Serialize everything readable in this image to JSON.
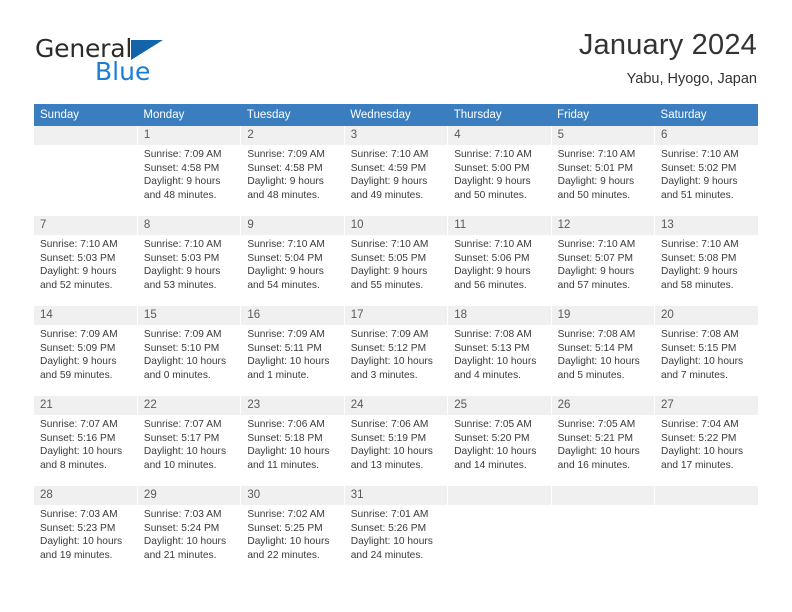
{
  "brand": {
    "name_part1": "General",
    "name_part2": "Blue",
    "triangle_color": "#1464aa",
    "blue_text_color": "#1a7fd4"
  },
  "header": {
    "title": "January 2024",
    "subtitle": "Yabu, Hyogo, Japan"
  },
  "theme": {
    "header_row_bg": "#3a7ebf",
    "daynum_bg": "#f0f0f0",
    "text_color": "#3b3b3b"
  },
  "weekday_headers": [
    "Sunday",
    "Monday",
    "Tuesday",
    "Wednesday",
    "Thursday",
    "Friday",
    "Saturday"
  ],
  "weeks": [
    [
      {
        "day": "",
        "sunrise": "",
        "sunset": "",
        "daylight": "",
        "daylight2": "",
        "empty": true
      },
      {
        "day": "1",
        "sunrise": "Sunrise: 7:09 AM",
        "sunset": "Sunset: 4:58 PM",
        "daylight": "Daylight: 9 hours",
        "daylight2": "and 48 minutes."
      },
      {
        "day": "2",
        "sunrise": "Sunrise: 7:09 AM",
        "sunset": "Sunset: 4:58 PM",
        "daylight": "Daylight: 9 hours",
        "daylight2": "and 48 minutes."
      },
      {
        "day": "3",
        "sunrise": "Sunrise: 7:10 AM",
        "sunset": "Sunset: 4:59 PM",
        "daylight": "Daylight: 9 hours",
        "daylight2": "and 49 minutes."
      },
      {
        "day": "4",
        "sunrise": "Sunrise: 7:10 AM",
        "sunset": "Sunset: 5:00 PM",
        "daylight": "Daylight: 9 hours",
        "daylight2": "and 50 minutes."
      },
      {
        "day": "5",
        "sunrise": "Sunrise: 7:10 AM",
        "sunset": "Sunset: 5:01 PM",
        "daylight": "Daylight: 9 hours",
        "daylight2": "and 50 minutes."
      },
      {
        "day": "6",
        "sunrise": "Sunrise: 7:10 AM",
        "sunset": "Sunset: 5:02 PM",
        "daylight": "Daylight: 9 hours",
        "daylight2": "and 51 minutes."
      }
    ],
    [
      {
        "day": "7",
        "sunrise": "Sunrise: 7:10 AM",
        "sunset": "Sunset: 5:03 PM",
        "daylight": "Daylight: 9 hours",
        "daylight2": "and 52 minutes."
      },
      {
        "day": "8",
        "sunrise": "Sunrise: 7:10 AM",
        "sunset": "Sunset: 5:03 PM",
        "daylight": "Daylight: 9 hours",
        "daylight2": "and 53 minutes."
      },
      {
        "day": "9",
        "sunrise": "Sunrise: 7:10 AM",
        "sunset": "Sunset: 5:04 PM",
        "daylight": "Daylight: 9 hours",
        "daylight2": "and 54 minutes."
      },
      {
        "day": "10",
        "sunrise": "Sunrise: 7:10 AM",
        "sunset": "Sunset: 5:05 PM",
        "daylight": "Daylight: 9 hours",
        "daylight2": "and 55 minutes."
      },
      {
        "day": "11",
        "sunrise": "Sunrise: 7:10 AM",
        "sunset": "Sunset: 5:06 PM",
        "daylight": "Daylight: 9 hours",
        "daylight2": "and 56 minutes."
      },
      {
        "day": "12",
        "sunrise": "Sunrise: 7:10 AM",
        "sunset": "Sunset: 5:07 PM",
        "daylight": "Daylight: 9 hours",
        "daylight2": "and 57 minutes."
      },
      {
        "day": "13",
        "sunrise": "Sunrise: 7:10 AM",
        "sunset": "Sunset: 5:08 PM",
        "daylight": "Daylight: 9 hours",
        "daylight2": "and 58 minutes."
      }
    ],
    [
      {
        "day": "14",
        "sunrise": "Sunrise: 7:09 AM",
        "sunset": "Sunset: 5:09 PM",
        "daylight": "Daylight: 9 hours",
        "daylight2": "and 59 minutes."
      },
      {
        "day": "15",
        "sunrise": "Sunrise: 7:09 AM",
        "sunset": "Sunset: 5:10 PM",
        "daylight": "Daylight: 10 hours",
        "daylight2": "and 0 minutes."
      },
      {
        "day": "16",
        "sunrise": "Sunrise: 7:09 AM",
        "sunset": "Sunset: 5:11 PM",
        "daylight": "Daylight: 10 hours",
        "daylight2": "and 1 minute."
      },
      {
        "day": "17",
        "sunrise": "Sunrise: 7:09 AM",
        "sunset": "Sunset: 5:12 PM",
        "daylight": "Daylight: 10 hours",
        "daylight2": "and 3 minutes."
      },
      {
        "day": "18",
        "sunrise": "Sunrise: 7:08 AM",
        "sunset": "Sunset: 5:13 PM",
        "daylight": "Daylight: 10 hours",
        "daylight2": "and 4 minutes."
      },
      {
        "day": "19",
        "sunrise": "Sunrise: 7:08 AM",
        "sunset": "Sunset: 5:14 PM",
        "daylight": "Daylight: 10 hours",
        "daylight2": "and 5 minutes."
      },
      {
        "day": "20",
        "sunrise": "Sunrise: 7:08 AM",
        "sunset": "Sunset: 5:15 PM",
        "daylight": "Daylight: 10 hours",
        "daylight2": "and 7 minutes."
      }
    ],
    [
      {
        "day": "21",
        "sunrise": "Sunrise: 7:07 AM",
        "sunset": "Sunset: 5:16 PM",
        "daylight": "Daylight: 10 hours",
        "daylight2": "and 8 minutes."
      },
      {
        "day": "22",
        "sunrise": "Sunrise: 7:07 AM",
        "sunset": "Sunset: 5:17 PM",
        "daylight": "Daylight: 10 hours",
        "daylight2": "and 10 minutes."
      },
      {
        "day": "23",
        "sunrise": "Sunrise: 7:06 AM",
        "sunset": "Sunset: 5:18 PM",
        "daylight": "Daylight: 10 hours",
        "daylight2": "and 11 minutes."
      },
      {
        "day": "24",
        "sunrise": "Sunrise: 7:06 AM",
        "sunset": "Sunset: 5:19 PM",
        "daylight": "Daylight: 10 hours",
        "daylight2": "and 13 minutes."
      },
      {
        "day": "25",
        "sunrise": "Sunrise: 7:05 AM",
        "sunset": "Sunset: 5:20 PM",
        "daylight": "Daylight: 10 hours",
        "daylight2": "and 14 minutes."
      },
      {
        "day": "26",
        "sunrise": "Sunrise: 7:05 AM",
        "sunset": "Sunset: 5:21 PM",
        "daylight": "Daylight: 10 hours",
        "daylight2": "and 16 minutes."
      },
      {
        "day": "27",
        "sunrise": "Sunrise: 7:04 AM",
        "sunset": "Sunset: 5:22 PM",
        "daylight": "Daylight: 10 hours",
        "daylight2": "and 17 minutes."
      }
    ],
    [
      {
        "day": "28",
        "sunrise": "Sunrise: 7:03 AM",
        "sunset": "Sunset: 5:23 PM",
        "daylight": "Daylight: 10 hours",
        "daylight2": "and 19 minutes."
      },
      {
        "day": "29",
        "sunrise": "Sunrise: 7:03 AM",
        "sunset": "Sunset: 5:24 PM",
        "daylight": "Daylight: 10 hours",
        "daylight2": "and 21 minutes."
      },
      {
        "day": "30",
        "sunrise": "Sunrise: 7:02 AM",
        "sunset": "Sunset: 5:25 PM",
        "daylight": "Daylight: 10 hours",
        "daylight2": "and 22 minutes."
      },
      {
        "day": "31",
        "sunrise": "Sunrise: 7:01 AM",
        "sunset": "Sunset: 5:26 PM",
        "daylight": "Daylight: 10 hours",
        "daylight2": "and 24 minutes."
      },
      {
        "day": "",
        "sunrise": "",
        "sunset": "",
        "daylight": "",
        "daylight2": "",
        "empty": true
      },
      {
        "day": "",
        "sunrise": "",
        "sunset": "",
        "daylight": "",
        "daylight2": "",
        "empty": true
      },
      {
        "day": "",
        "sunrise": "",
        "sunset": "",
        "daylight": "",
        "daylight2": "",
        "empty": true
      }
    ]
  ]
}
